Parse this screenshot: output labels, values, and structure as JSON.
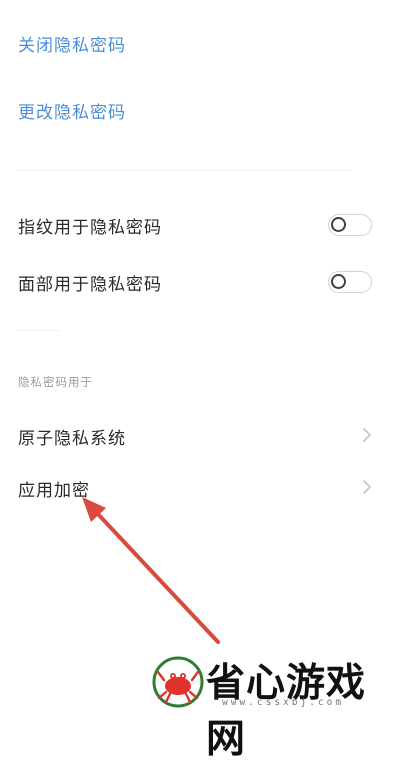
{
  "privacy_password": {
    "close_label": "关闭隐私密码",
    "change_label": "更改隐私密码"
  },
  "biometrics": {
    "fingerprint_label": "指纹用于隐私密码",
    "fingerprint_enabled": false,
    "face_label": "面部用于隐私密码",
    "face_enabled": false
  },
  "usage_section": {
    "caption": "隐私密码用于",
    "items": [
      {
        "label": "原子隐私系统"
      },
      {
        "label": "应用加密"
      }
    ]
  },
  "annotation": {
    "arrow_color": "#d94a3e"
  },
  "watermark": {
    "name": "省心游戏网",
    "url": "www.cssxbj.com",
    "logo_color": "#e0312b"
  }
}
